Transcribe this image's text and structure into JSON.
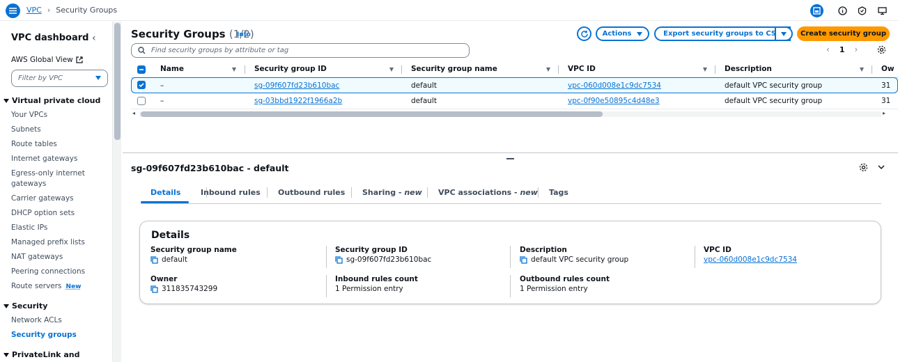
{
  "breadcrumb": {
    "root": "VPC",
    "current": "Security Groups"
  },
  "sidebar": {
    "title": "VPC dashboard",
    "global_view": "AWS Global View",
    "filter_placeholder": "Filter by VPC",
    "sections": [
      {
        "label": "Virtual private cloud",
        "items": [
          "Your VPCs",
          "Subnets",
          "Route tables",
          "Internet gateways",
          "Egress-only internet gateways",
          "Carrier gateways",
          "DHCP option sets",
          "Elastic IPs",
          "Managed prefix lists",
          "NAT gateways",
          "Peering connections",
          "Route servers"
        ]
      },
      {
        "label": "Security",
        "items": [
          "Network ACLs",
          "Security groups"
        ]
      },
      {
        "label": "PrivateLink and"
      }
    ],
    "new_badge": "New",
    "active_item": "Security groups"
  },
  "header": {
    "title": "Security Groups",
    "count": "(1/2)",
    "info": "Info",
    "actions_label": "Actions",
    "export_label": "Export security groups to CSV",
    "create_label": "Create security group",
    "search_placeholder": "Find security groups by attribute or tag",
    "page": "1"
  },
  "table": {
    "columns": [
      "Name",
      "Security group ID",
      "Security group name",
      "VPC ID",
      "Description",
      "Ow"
    ],
    "rows": [
      {
        "selected": true,
        "name": "–",
        "sg_id": "sg-09f607fd23b610bac",
        "sg_name": "default",
        "vpc_id": "vpc-060d008e1c9dc7534",
        "description": "default VPC security group",
        "owner": "31"
      },
      {
        "selected": false,
        "name": "–",
        "sg_id": "sg-03bbd1922f1966a2b",
        "sg_name": "default",
        "vpc_id": "vpc-0f90e50895c4d48e3",
        "description": "default VPC security group",
        "owner": "31"
      }
    ]
  },
  "detail": {
    "title": "sg-09f607fd23b610bac - default",
    "tabs": [
      {
        "label": "Details"
      },
      {
        "label": "Inbound rules"
      },
      {
        "label": "Outbound rules"
      },
      {
        "label": "Sharing - ",
        "suffix": "new"
      },
      {
        "label": "VPC associations - ",
        "suffix": "new"
      },
      {
        "label": "Tags"
      }
    ],
    "card_title": "Details",
    "fields": {
      "sg_name": {
        "label": "Security group name",
        "value": "default"
      },
      "sg_id": {
        "label": "Security group ID",
        "value": "sg-09f607fd23b610bac"
      },
      "description": {
        "label": "Description",
        "value": "default VPC security group"
      },
      "vpc_id": {
        "label": "VPC ID",
        "value": "vpc-060d008e1c9dc7534"
      },
      "owner": {
        "label": "Owner",
        "value": "311835743299"
      },
      "inbound": {
        "label": "Inbound rules count",
        "value": "1 Permission entry"
      },
      "outbound": {
        "label": "Outbound rules count",
        "value": "1 Permission entry"
      }
    }
  },
  "colors": {
    "accent": "#0972d3",
    "primary_button": "#ff9900"
  }
}
